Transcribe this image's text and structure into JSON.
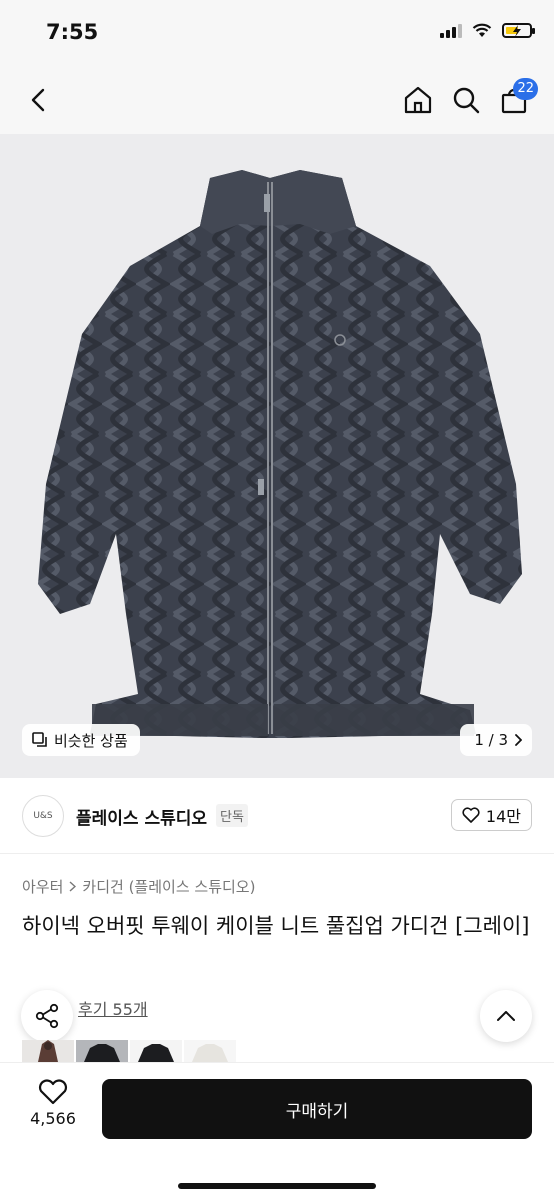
{
  "status_bar": {
    "time": "7:55"
  },
  "nav": {
    "cart_count": "22"
  },
  "gallery": {
    "similar_label": "비슷한 상품",
    "page_indicator": "1 / 3"
  },
  "brand": {
    "logo_text": "U&S",
    "name": "플레이스 스튜디오",
    "tag": "단독",
    "likes": "14만"
  },
  "breadcrumb": {
    "category": "아우터",
    "subcategory": "카디건 (플레이스 스튜디오)"
  },
  "product": {
    "title": "하이넥 오버핏 투웨이 케이블 니트 풀집업 가디건 [그레이]",
    "reviews": "후기 55개"
  },
  "bottom_bar": {
    "wish_count": "4,566",
    "buy_label": "구매하기"
  },
  "colors": {
    "accent": "#2b6fe8",
    "product_knit": "#3b3f4a",
    "buy_button": "#111111"
  }
}
